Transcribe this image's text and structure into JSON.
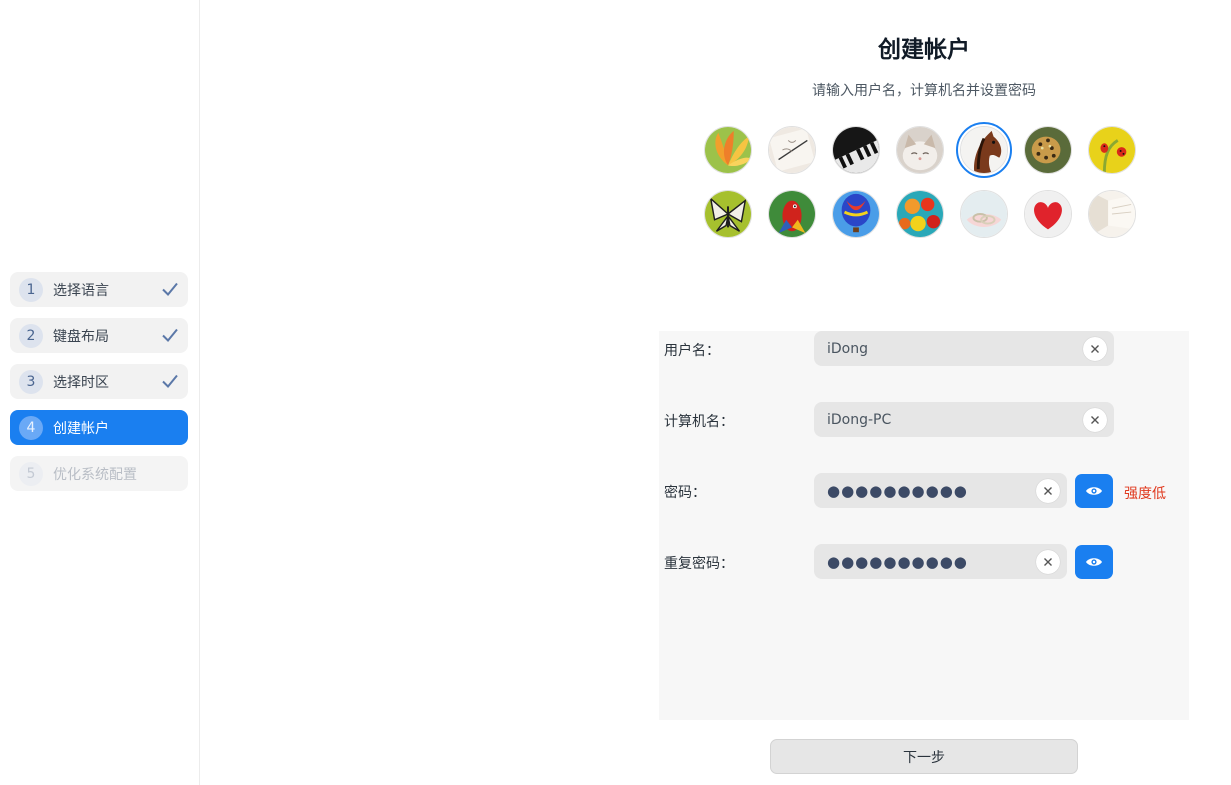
{
  "steps": [
    {
      "number": "1",
      "label": "选择语言",
      "state": "done"
    },
    {
      "number": "2",
      "label": "键盘布局",
      "state": "done"
    },
    {
      "number": "3",
      "label": "选择时区",
      "state": "done"
    },
    {
      "number": "4",
      "label": "创建帐户",
      "state": "active"
    },
    {
      "number": "5",
      "label": "优化系统配置",
      "state": "disabled"
    }
  ],
  "header": {
    "title": "创建帐户",
    "subtitle": "请输入用户名，计算机名并设置密码"
  },
  "avatars": [
    {
      "name": "flower-avatar",
      "selected": false
    },
    {
      "name": "notebook-avatar",
      "selected": false
    },
    {
      "name": "piano-avatar",
      "selected": false
    },
    {
      "name": "kitten-avatar",
      "selected": false
    },
    {
      "name": "horse-avatar",
      "selected": true
    },
    {
      "name": "leopard-avatar",
      "selected": false
    },
    {
      "name": "ladybug-avatar",
      "selected": false
    },
    {
      "name": "butterfly-avatar",
      "selected": false
    },
    {
      "name": "parrot-avatar",
      "selected": false
    },
    {
      "name": "hot-air-balloon-avatar",
      "selected": false
    },
    {
      "name": "balloons-avatar",
      "selected": false
    },
    {
      "name": "rings-avatar",
      "selected": false
    },
    {
      "name": "heart-avatar",
      "selected": false
    },
    {
      "name": "room-avatar",
      "selected": false
    }
  ],
  "form": {
    "username_label": "用户名：",
    "username_value": "iDong",
    "computer_label": "计算机名：",
    "computer_value": "iDong-PC",
    "password_label": "密码：",
    "password_value": "●●●●●●●●●●",
    "password_strength": "强度低",
    "repeat_label": "重复密码：",
    "repeat_value": "●●●●●●●●●●"
  },
  "footer": {
    "next_label": "下一步"
  },
  "colors": {
    "accent": "#1a7ff0",
    "warning": "#e0391e"
  }
}
